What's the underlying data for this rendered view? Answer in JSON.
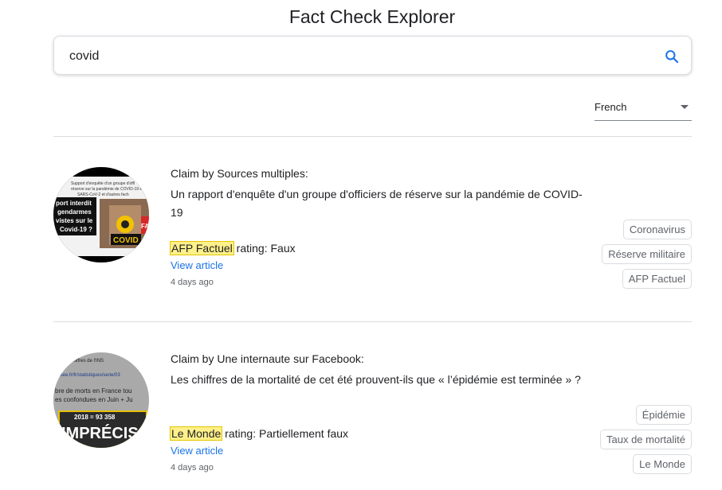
{
  "page": {
    "title": "Fact Check Explorer"
  },
  "search": {
    "value": "covid",
    "icon": "search-icon"
  },
  "language": {
    "selected": "French"
  },
  "colors": {
    "accent": "#1a73e8",
    "highlight": "#fef08a",
    "tag_border": "#dadce0"
  },
  "claims": [
    {
      "claim_by": "Claim by Sources multiples:",
      "text": "Un rapport d'enquête d'un groupe d'officiers de réserve sur la pandémie de COVID-19",
      "publisher": "AFP Factuel",
      "rating_label": "rating:",
      "rating": "Faux",
      "view_label": "View article",
      "time": "4 days ago",
      "tags": [
        "Coronavirus",
        "Réserve militaire",
        "AFP Factuel"
      ],
      "thumb": {
        "lines": [
          "Support d'enquête d'un groupe d'offi",
          "réserve sur la pandémie de COVID-19 e",
          "SARS-CoV-2 et d'autres fach"
        ],
        "banner": [
          "port interdit",
          "gendarmes",
          "vistes sur le",
          "Covid-19 ?"
        ],
        "badge": "COVID",
        "badge2": "FA"
      }
    },
    {
      "claim_by": "Claim by Une internaute sur Facebook:",
      "text": "Les chiffres de la mortalité de cet été prouvent-ils que « l’épidémie est terminée » ?",
      "publisher": "Le Monde",
      "rating_label": "rating:",
      "rating": "Partiellement faux",
      "view_label": "View article",
      "time": "4 days ago",
      "tags": [
        "Épidémie",
        "Taux de mortalité",
        "Le Monde"
      ],
      "thumb": {
        "lines": [
          "ec les chiffres de l'INS",
          "ici :",
          "insee.fr/fr/statistiques/serie/03",
          "bre de morts en France tou",
          "es confondues en Juin + Ju"
        ],
        "stat": "2018 = 93 358",
        "stamp": "IMPRÉCIS"
      }
    }
  ]
}
